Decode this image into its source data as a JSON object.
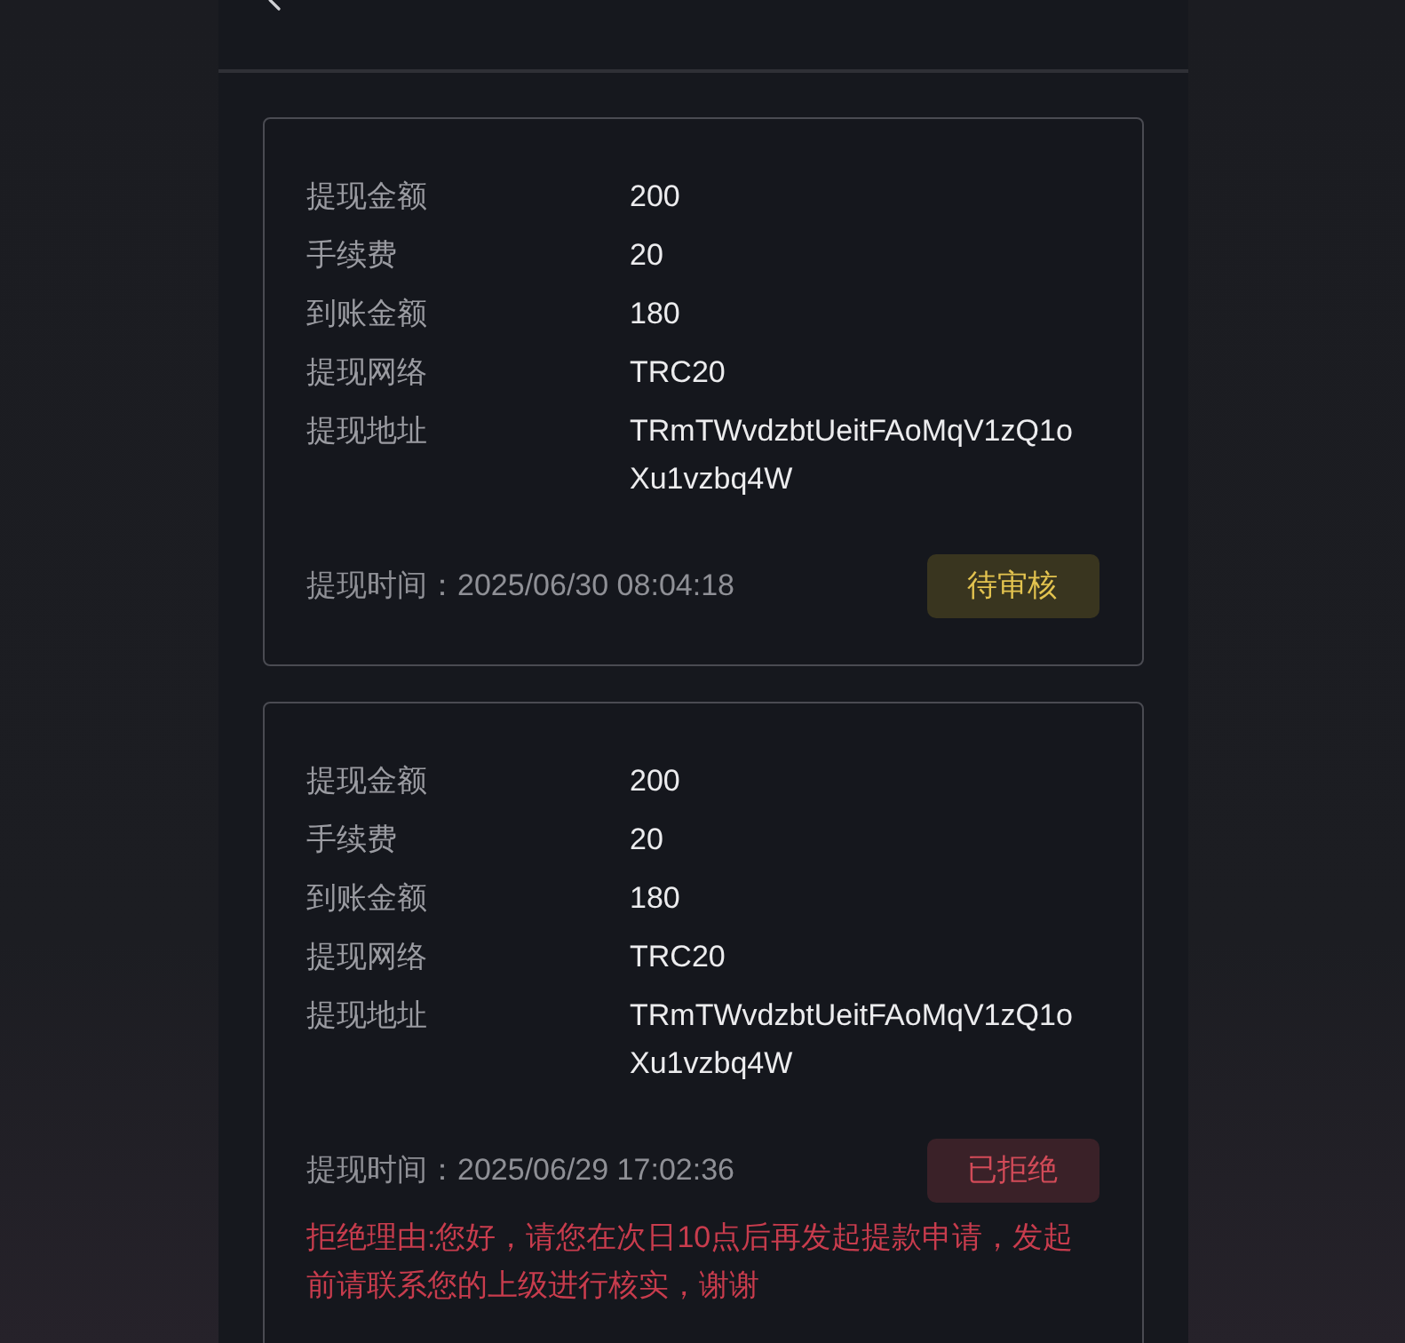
{
  "records": [
    {
      "fields": [
        {
          "label": "提现金额",
          "value": "200"
        },
        {
          "label": "手续费",
          "value": "20"
        },
        {
          "label": "到账金额",
          "value": "180"
        },
        {
          "label": "提现网络",
          "value": "TRC20"
        },
        {
          "label": "提现地址",
          "value": "TRmTWvdzbtUeitFAoMqV1zQ1oXu1vzbq4W"
        }
      ],
      "time_label": "提现时间：",
      "time": "2025/06/30 08:04:18",
      "status": {
        "kind": "pending",
        "label": "待审核"
      }
    },
    {
      "fields": [
        {
          "label": "提现金额",
          "value": "200"
        },
        {
          "label": "手续费",
          "value": "20"
        },
        {
          "label": "到账金额",
          "value": "180"
        },
        {
          "label": "提现网络",
          "value": "TRC20"
        },
        {
          "label": "提现地址",
          "value": "TRmTWvdzbtUeitFAoMqV1zQ1oXu1vzbq4W"
        }
      ],
      "time_label": "提现时间：",
      "time": "2025/06/29 17:02:36",
      "status": {
        "kind": "rejected",
        "label": "已拒绝"
      },
      "reason": "拒绝理由:您好，请您在次日10点后再发起提款申请，发起前请联系您的上级进行核实，谢谢"
    }
  ]
}
